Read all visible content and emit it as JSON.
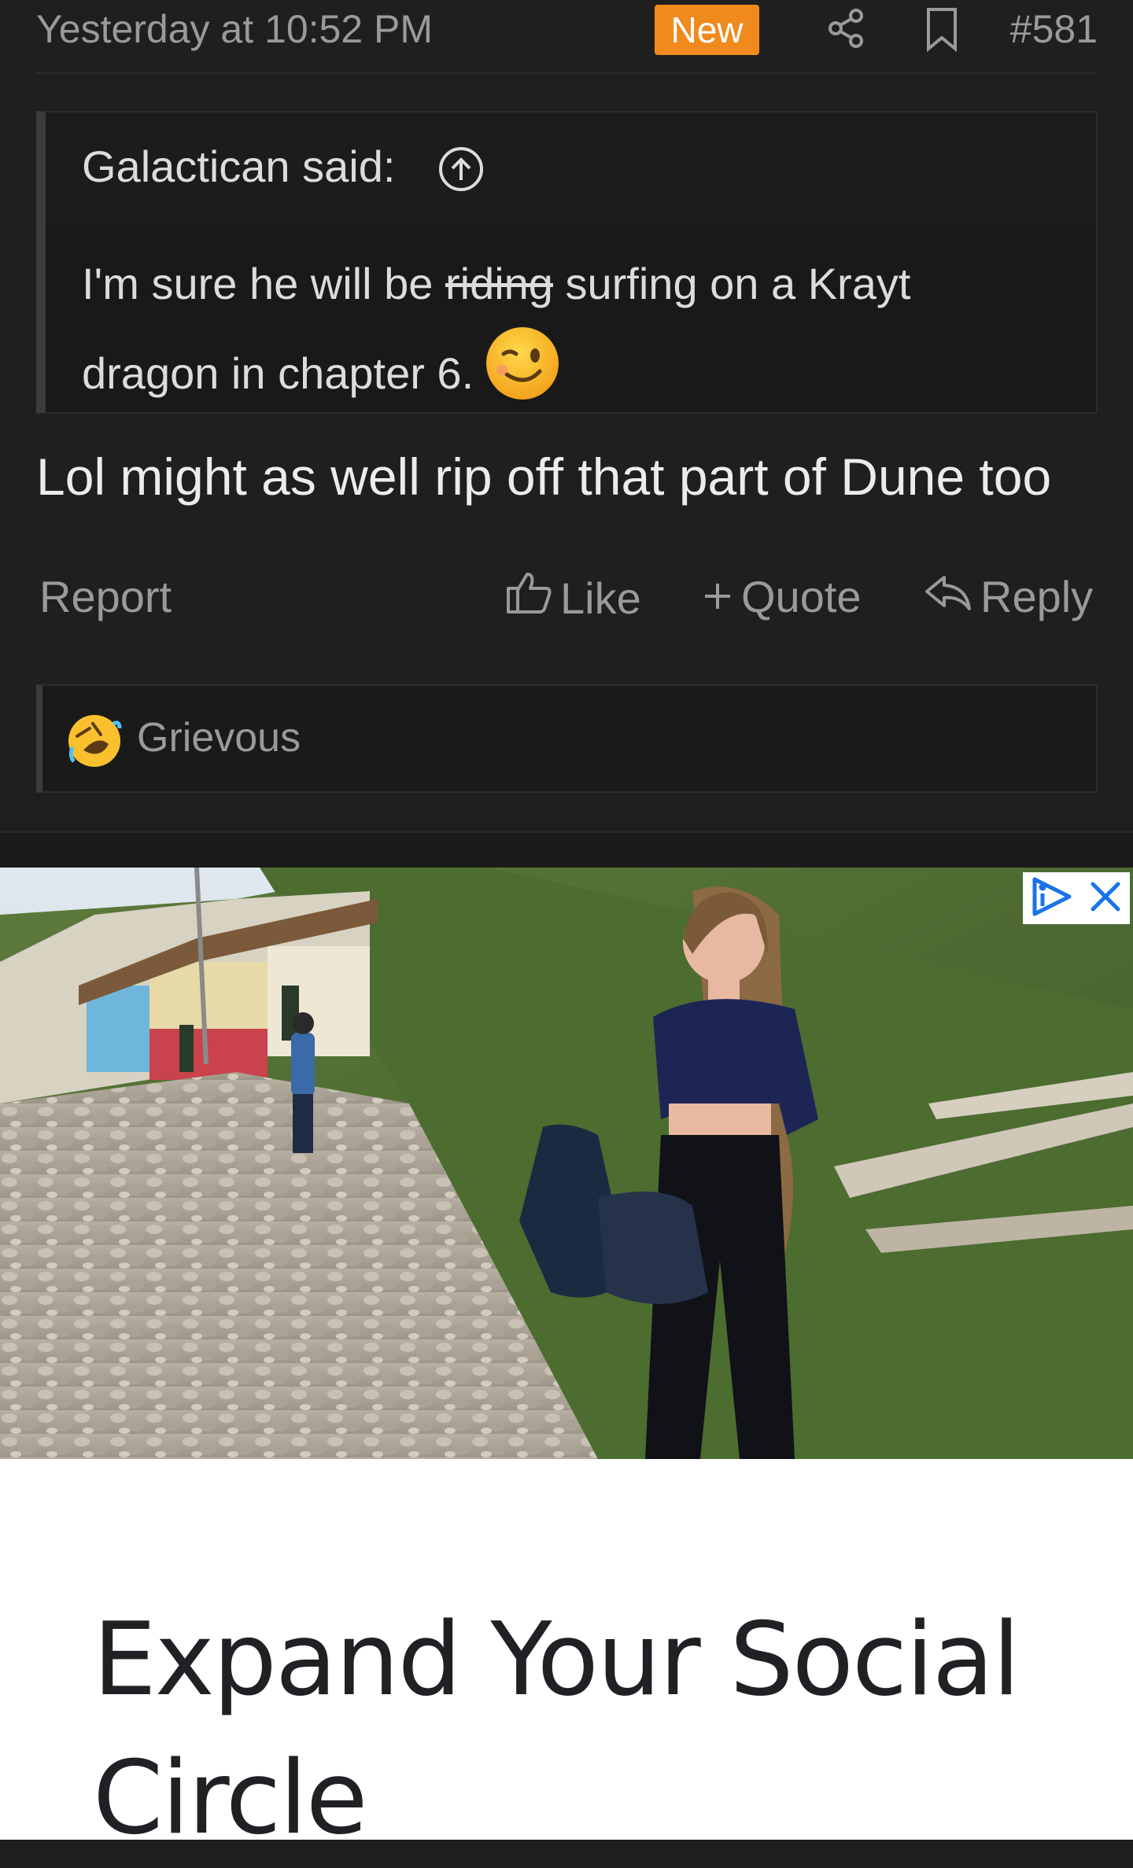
{
  "post": {
    "timestamp": "Yesterday at 10:52 PM",
    "new_badge": "New",
    "post_number": "#581",
    "quote": {
      "author": "Galactican said:",
      "text_before": "I'm sure he will be ",
      "text_struck": "riding",
      "text_after": " surfing on a Krayt dragon in chapter 6."
    },
    "message": "Lol might as well rip off that part of Dune too",
    "actions": {
      "report": "Report",
      "like": "Like",
      "quote": "Quote",
      "reply": "Reply"
    },
    "reactions": {
      "user": "Grievous"
    }
  },
  "ad": {
    "title": "Expand Your Social Circle"
  },
  "colors": {
    "background": "#1f1f1f",
    "new_badge": "#f08a1c",
    "ad_background": "#ffffff",
    "ad_choices": "#1a73e8"
  }
}
